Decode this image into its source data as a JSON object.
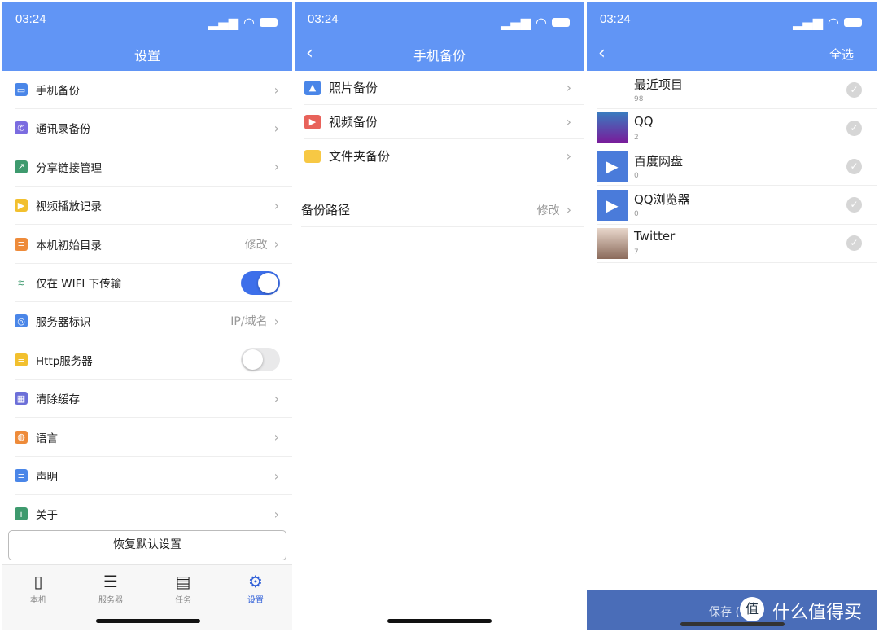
{
  "status": {
    "time": "03:24"
  },
  "colors": {
    "header": "#6195F5",
    "toggle_on": "#3D6FEA",
    "active_tab": "#2F5FD8",
    "save_bar": "#4A6DB8"
  },
  "settings": {
    "title": "设置",
    "items": [
      {
        "label": "手机备份",
        "icon": "tablet-icon"
      },
      {
        "label": "通讯录备份",
        "icon": "contacts-icon"
      },
      {
        "label": "分享链接管理",
        "icon": "share-icon"
      },
      {
        "label": "视频播放记录",
        "icon": "play-history-icon"
      },
      {
        "label": "本机初始目录",
        "icon": "list-icon",
        "value": "修改"
      },
      {
        "label": "仅在 WIFI 下传输",
        "icon": "wifi-icon",
        "toggle": true
      },
      {
        "label": "服务器标识",
        "icon": "server-id-icon",
        "value": "IP/域名"
      },
      {
        "label": "Http服务器",
        "icon": "http-server-icon",
        "toggle": false
      },
      {
        "label": "清除缓存",
        "icon": "broom-icon"
      },
      {
        "label": "语言",
        "icon": "globe-icon"
      },
      {
        "label": "声明",
        "icon": "message-icon"
      },
      {
        "label": "关于",
        "icon": "info-icon"
      }
    ],
    "reset_button": "恢复默认设置",
    "tabs": [
      {
        "label": "本机"
      },
      {
        "label": "服务器"
      },
      {
        "label": "任务"
      },
      {
        "label": "设置",
        "active": true
      }
    ]
  },
  "backup": {
    "title": "手机备份",
    "items": [
      {
        "label": "照片备份"
      },
      {
        "label": "视频备份"
      },
      {
        "label": "文件夹备份"
      }
    ],
    "path": {
      "label": "备份路径",
      "value": "修改"
    }
  },
  "albums": {
    "select_all": "全选",
    "items": [
      {
        "name": "最近项目",
        "count": "98"
      },
      {
        "name": "QQ",
        "count": "2"
      },
      {
        "name": "百度网盘",
        "count": "0"
      },
      {
        "name": "QQ浏览器",
        "count": "0"
      },
      {
        "name": "Twitter",
        "count": "7"
      }
    ],
    "save": "保存 (",
    "watermark": "什么值得买"
  }
}
